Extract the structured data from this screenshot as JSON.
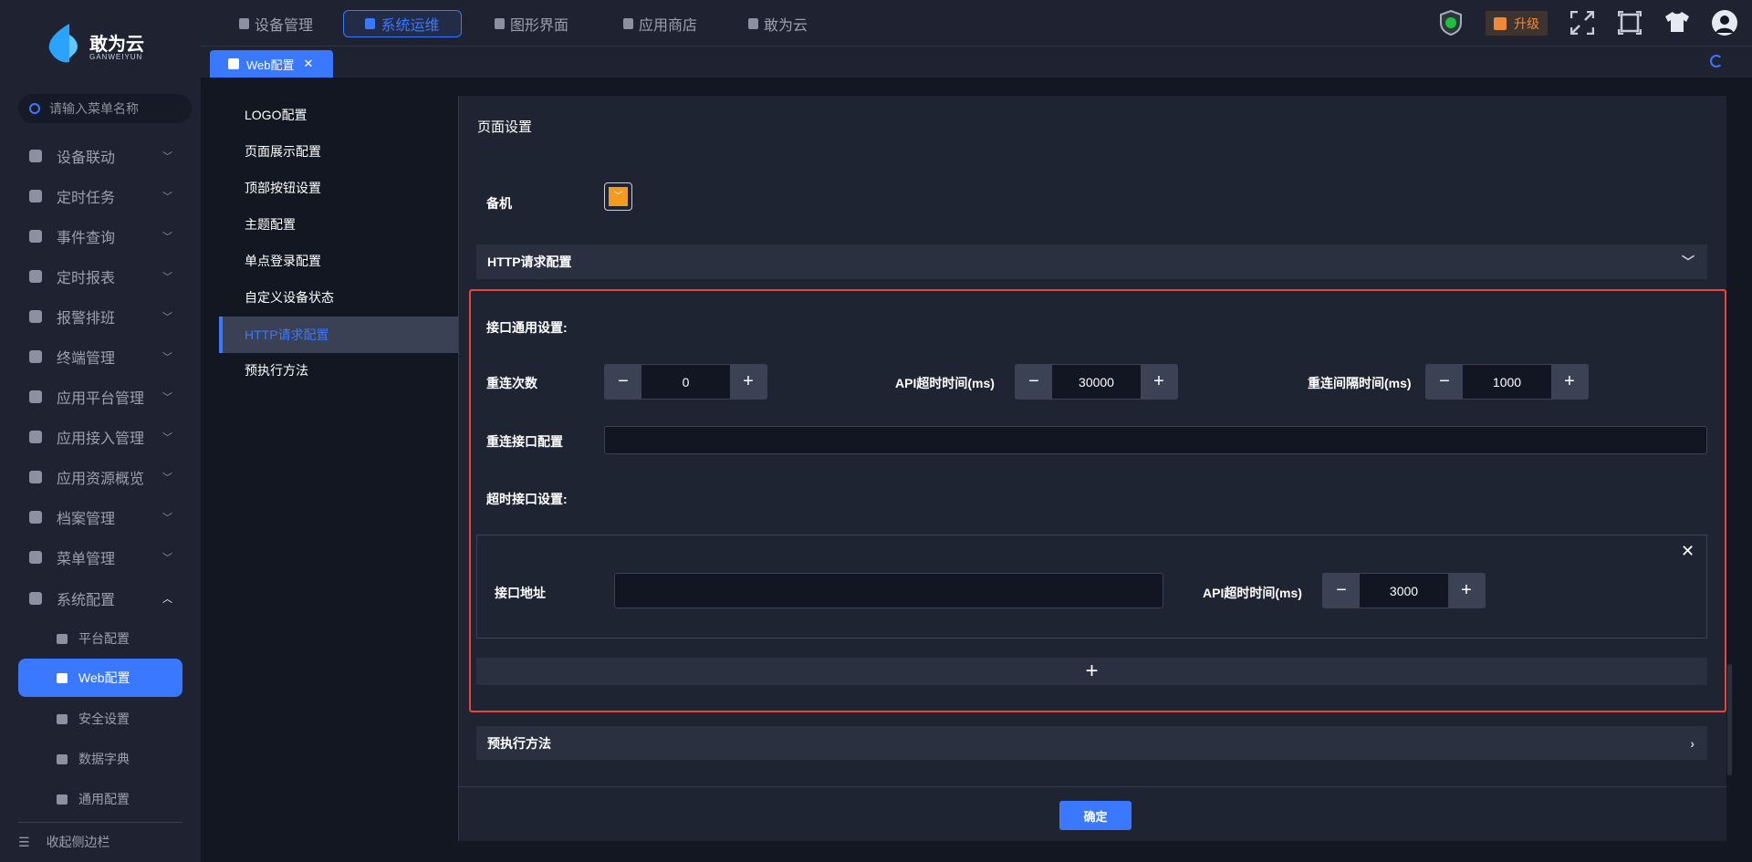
{
  "brand": {
    "name": "敢为云",
    "sub": "GANWEIYUN"
  },
  "sidebar": {
    "search_placeholder": "请输入菜单名称",
    "items": [
      {
        "label": "设备联动"
      },
      {
        "label": "定时任务"
      },
      {
        "label": "事件查询"
      },
      {
        "label": "定时报表"
      },
      {
        "label": "报警排班"
      },
      {
        "label": "终端管理"
      },
      {
        "label": "应用平台管理"
      },
      {
        "label": "应用接入管理"
      },
      {
        "label": "应用资源概览"
      },
      {
        "label": "档案管理"
      },
      {
        "label": "菜单管理"
      },
      {
        "label": "系统配置"
      }
    ],
    "sub_items": [
      {
        "label": "平台配置"
      },
      {
        "label": "Web配置"
      },
      {
        "label": "安全设置"
      },
      {
        "label": "数据字典"
      },
      {
        "label": "通用配置"
      }
    ],
    "collapse_label": "收起侧边栏"
  },
  "topnav": {
    "items": [
      {
        "label": "设备管理"
      },
      {
        "label": "系统运维"
      },
      {
        "label": "图形界面"
      },
      {
        "label": "应用商店"
      },
      {
        "label": "敢为云"
      }
    ],
    "upgrade_label": "升级"
  },
  "tabs": [
    {
      "label": "Web配置",
      "close": "✕"
    }
  ],
  "config_nav": [
    {
      "label": "LOGO配置"
    },
    {
      "label": "页面展示配置"
    },
    {
      "label": "顶部按钮设置"
    },
    {
      "label": "主题配置"
    },
    {
      "label": "单点登录配置"
    },
    {
      "label": "自定义设备状态"
    },
    {
      "label": "HTTP请求配置"
    },
    {
      "label": "预执行方法"
    }
  ],
  "main": {
    "title": "页面设置",
    "standby_label": "备机",
    "http_section": "HTTP请求配置",
    "common_title": "接口通用设置:",
    "retry_count_label": "重连次数",
    "retry_count": "0",
    "api_timeout_label": "API超时时间(ms)",
    "api_timeout": "30000",
    "retry_interval_label": "重连间隔时间(ms)",
    "retry_interval": "1000",
    "retry_api_label": "重连接口配置",
    "retry_api_value": "",
    "timeout_title": "超时接口设置:",
    "endpoint_label": "接口地址",
    "endpoint_value": "",
    "endpoint_timeout_label": "API超时时间(ms)",
    "endpoint_timeout": "3000",
    "pre_exec_section": "预执行方法",
    "confirm_label": "确定"
  },
  "colors": {
    "accent": "#3a78ff",
    "highlight": "#e8453c",
    "upgrade": "#f0883a",
    "dropdown": "#f39a1f"
  }
}
